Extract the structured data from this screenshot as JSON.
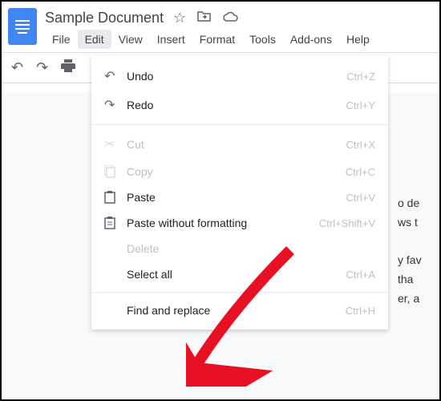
{
  "header": {
    "title": "Sample Document"
  },
  "menubar": {
    "items": [
      "File",
      "Edit",
      "View",
      "Insert",
      "Format",
      "Tools",
      "Add-ons",
      "Help"
    ],
    "active": "Edit"
  },
  "edit_menu": {
    "undo": {
      "label": "Undo",
      "shortcut": "Ctrl+Z"
    },
    "redo": {
      "label": "Redo",
      "shortcut": "Ctrl+Y"
    },
    "cut": {
      "label": "Cut",
      "shortcut": "Ctrl+X"
    },
    "copy": {
      "label": "Copy",
      "shortcut": "Ctrl+C"
    },
    "paste": {
      "label": "Paste",
      "shortcut": "Ctrl+V"
    },
    "paste_plain": {
      "label": "Paste without formatting",
      "shortcut": "Ctrl+Shift+V"
    },
    "delete": {
      "label": "Delete"
    },
    "select_all": {
      "label": "Select all",
      "shortcut": "Ctrl+A"
    },
    "find_replace": {
      "label": "Find and replace",
      "shortcut": "Ctrl+H"
    }
  },
  "doc_text": {
    "l1": "o de",
    "l2": "ws t",
    "l3": "y fav",
    "l4": "tha",
    "l5": "er, a"
  }
}
